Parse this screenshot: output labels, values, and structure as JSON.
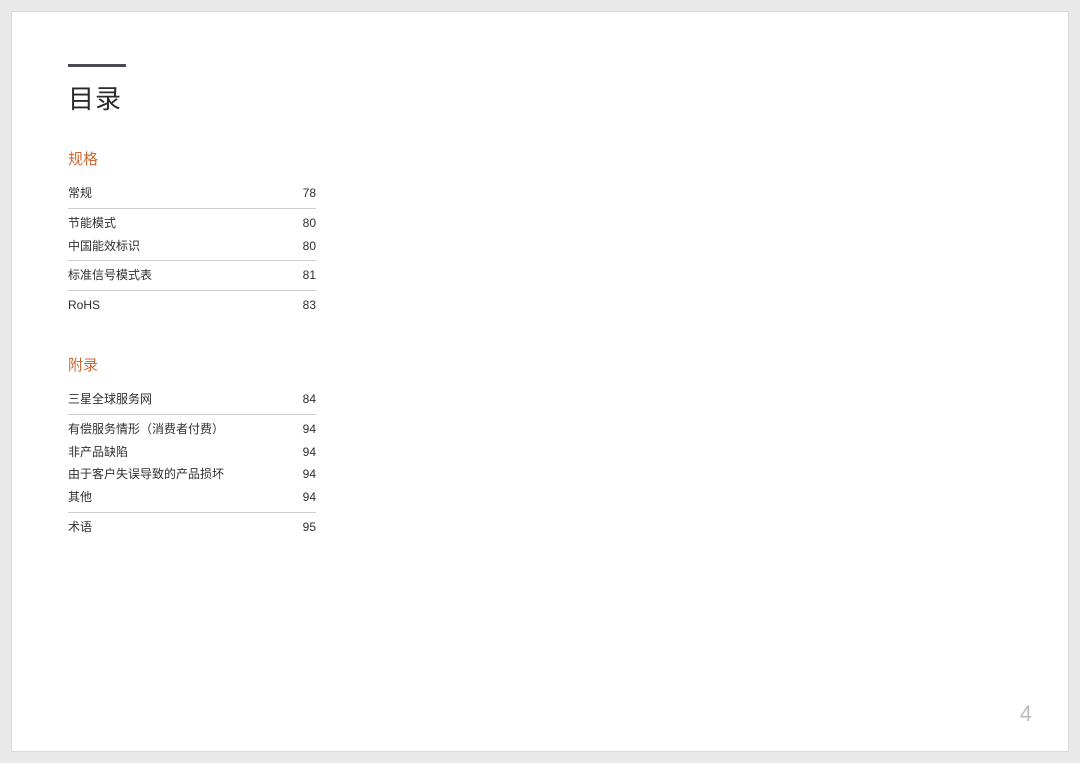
{
  "page_title": "目录",
  "page_number": "4",
  "sections": [
    {
      "heading": "规格",
      "groups": [
        [
          {
            "label": "常规",
            "page": "78"
          }
        ],
        [
          {
            "label": "节能模式",
            "page": "80"
          },
          {
            "label": "中国能效标识",
            "page": "80"
          }
        ],
        [
          {
            "label": "标准信号模式表",
            "page": "81"
          }
        ],
        [
          {
            "label": "RoHS",
            "page": "83"
          }
        ]
      ]
    },
    {
      "heading": "附录",
      "groups": [
        [
          {
            "label": "三星全球服务网",
            "page": "84"
          }
        ],
        [
          {
            "label": "有偿服务情形（消费者付费）",
            "page": "94"
          },
          {
            "label": "非产品缺陷",
            "page": "94"
          },
          {
            "label": "由于客户失误导致的产品损坏",
            "page": "94"
          },
          {
            "label": "其他",
            "page": "94"
          }
        ],
        [
          {
            "label": "术语",
            "page": "95"
          }
        ]
      ]
    }
  ]
}
